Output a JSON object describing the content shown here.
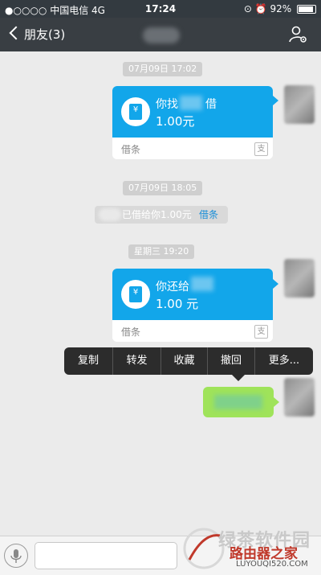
{
  "status_bar": {
    "signal": "●○○○○",
    "carrier": "中国电信",
    "network": "4G",
    "time": "17:24",
    "battery_percent": "92%",
    "battery_level": 0.92
  },
  "nav": {
    "back_label": "朋友(3)"
  },
  "messages": {
    "ts1": "07月09日 17:02",
    "card1": {
      "line1": "你找",
      "line1_suffix": "借",
      "amount": "1.00元",
      "label": "借条",
      "brand": "支"
    },
    "ts2": "07月09日 18:05",
    "notice": {
      "text": "已借给你1.00元",
      "link": "借条"
    },
    "ts3": "星期三 19:20",
    "card2": {
      "line1": "你还给",
      "amount": "1.00 元",
      "label": "借条",
      "brand": "支"
    }
  },
  "context_menu": {
    "items": [
      "复制",
      "转发",
      "收藏",
      "撤回",
      "更多..."
    ]
  },
  "watermark": {
    "text_big": "绿茶软件园",
    "text_red": "路由器之家",
    "url": "LUYOUQI520.COM"
  },
  "colors": {
    "card_blue": "#12a6ea",
    "bubble_green": "#9fe35a",
    "nav_bg": "#393e43",
    "link_blue": "#1a8ed8"
  }
}
